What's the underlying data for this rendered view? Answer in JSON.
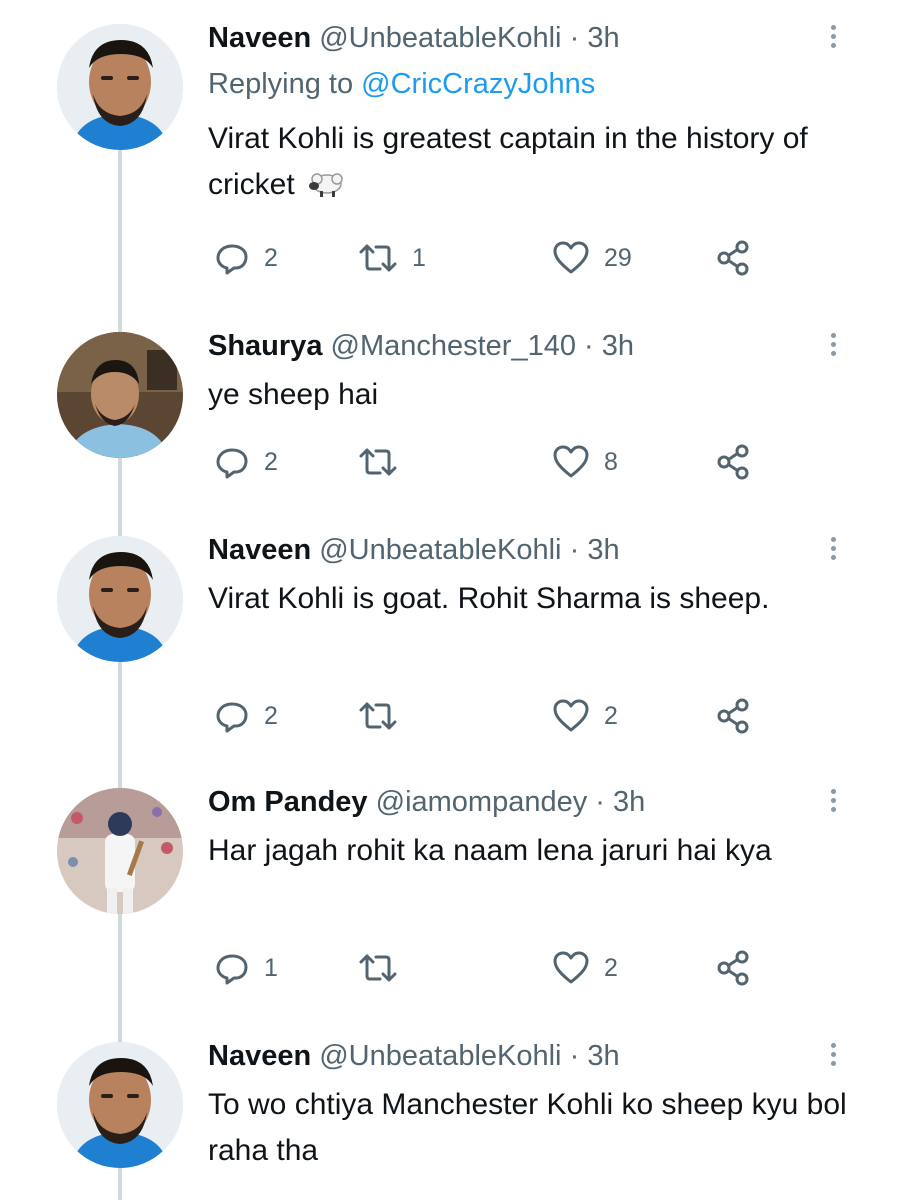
{
  "tweets": [
    {
      "name": "Naveen",
      "handle": "@UnbeatableKohli",
      "sep": "·",
      "time": "3h",
      "reply_prefix": "Replying to",
      "reply_mention": "@CricCrazyJohns",
      "text": "Virat Kohli is greatest captain in the history of cricket",
      "emoji": "sheep-emoji",
      "replies": "2",
      "retweets": "1",
      "likes": "29"
    },
    {
      "name": "Shaurya",
      "handle": "@Manchester_140",
      "sep": "·",
      "time": "3h",
      "text": "ye sheep hai",
      "replies": "2",
      "retweets": "",
      "likes": "8"
    },
    {
      "name": "Naveen",
      "handle": "@UnbeatableKohli",
      "sep": "·",
      "time": "3h",
      "text": "Virat Kohli is goat. Rohit Sharma is sheep.",
      "replies": "2",
      "retweets": "",
      "likes": "2"
    },
    {
      "name": "Om Pandey",
      "handle": "@iamompandey",
      "sep": "·",
      "time": "3h",
      "text": "Har jagah rohit ka naam lena jaruri hai kya",
      "replies": "1",
      "retweets": "",
      "likes": "2"
    },
    {
      "name": "Naveen",
      "handle": "@UnbeatableKohli",
      "sep": "·",
      "time": "3h",
      "text": "To wo chtiya Manchester Kohli ko sheep kyu bol raha tha"
    }
  ],
  "icons": {
    "reply": "reply-icon",
    "retweet": "retweet-icon",
    "like": "heart-icon",
    "share": "share-icon",
    "more": "more-options-icon"
  },
  "colors": {
    "text": "#0f1419",
    "muted": "#536471",
    "link": "#1d9bf0",
    "thread_line": "#cfd9de"
  }
}
